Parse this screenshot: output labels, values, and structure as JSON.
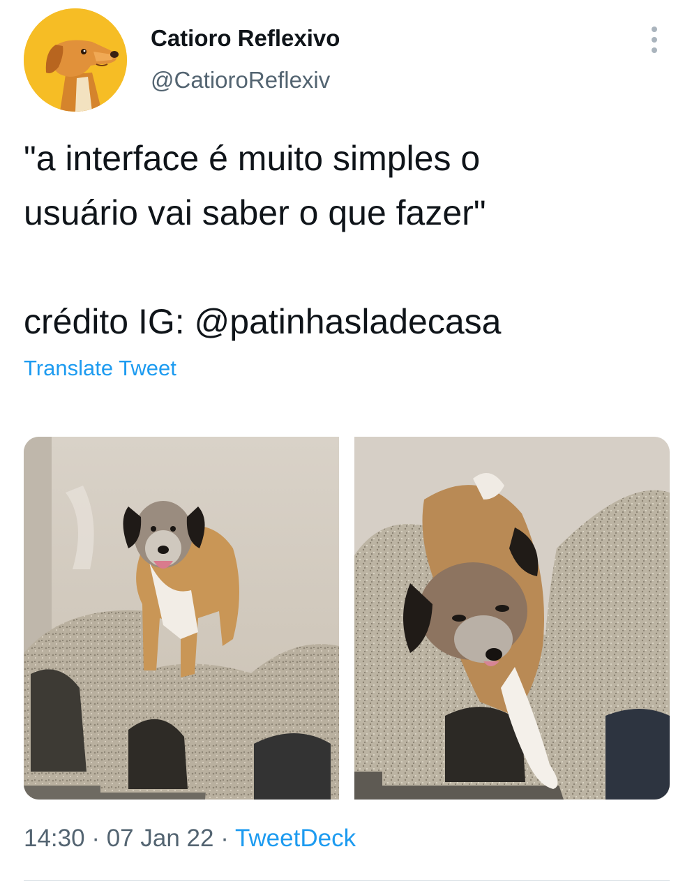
{
  "author": {
    "display_name": "Catioro Reflexivo",
    "handle": "@CatioroReflexiv",
    "avatar_icon": "cartoon-dog-avatar"
  },
  "more_icon": "more-options-icon",
  "tweet": {
    "text": "\"a interface é muito simples o\nusuário vai saber o que fazer\"\n\ncrédito IG: @patinhasladecasa",
    "translate_label": "Translate Tweet"
  },
  "meta": {
    "time": "14:30",
    "separator": "·",
    "date": "07 Jan 22",
    "source": "TweetDeck"
  },
  "colors": {
    "link": "#1d9bf0",
    "secondary_text": "#536471",
    "avatar_background": "#f6bd25"
  }
}
